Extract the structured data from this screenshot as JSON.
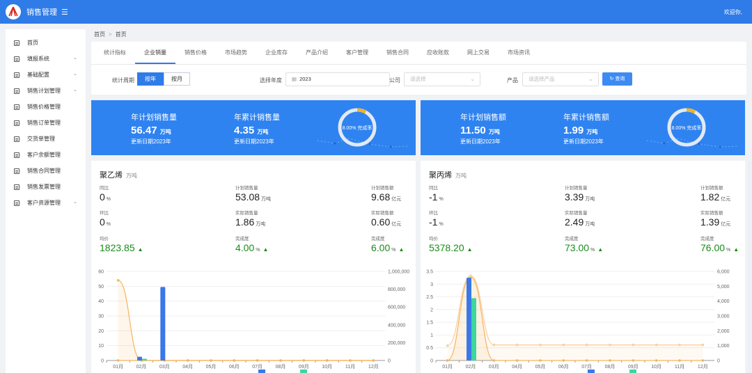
{
  "header": {
    "title": "销售管理",
    "welcome": "欢迎你,"
  },
  "sidebar": {
    "items": [
      {
        "label": "首页",
        "chev": false
      },
      {
        "label": "填报系统",
        "chev": true
      },
      {
        "label": "基础配置",
        "chev": true
      },
      {
        "label": "销售计划管理",
        "chev": true
      },
      {
        "label": "销售价格管理",
        "chev": false
      },
      {
        "label": "销售订单管理",
        "chev": false
      },
      {
        "label": "交货单管理",
        "chev": false
      },
      {
        "label": "客户余额管理",
        "chev": false
      },
      {
        "label": "销售合同管理",
        "chev": false
      },
      {
        "label": "销售发票管理",
        "chev": false
      },
      {
        "label": "客户资源管理",
        "chev": true
      }
    ]
  },
  "breadcrumb": [
    "首页",
    "首页"
  ],
  "tabs": [
    "统计指标",
    "企业销量",
    "销售价格",
    "市场趋势",
    "企业库存",
    "产品介绍",
    "客户管理",
    "销售合同",
    "应收账款",
    "网上交易",
    "市场资讯"
  ],
  "active_tab": 1,
  "filters": {
    "period_label": "统计周期",
    "period_options": [
      "按年",
      "按月"
    ],
    "year_label": "选择年度",
    "year_value": "2023",
    "company_label": "公司",
    "company_placeholder": "请选择",
    "product_label": "产品",
    "product_placeholder": "请选择产品",
    "query_label": "查询"
  },
  "kpi_left": {
    "a_label": "年计划销售量",
    "a_value": "56.47",
    "a_unit": "万吨",
    "a_date": "更新日期2023年",
    "b_label": "年累计销售量",
    "b_value": "4.35",
    "b_unit": "万吨",
    "b_date": "更新日期2023年",
    "ring_text": "8.00% 完成率",
    "ring_pct": 8
  },
  "kpi_right": {
    "a_label": "年计划销售额",
    "a_value": "11.50",
    "a_unit": "万吨",
    "a_date": "更新日期2023年",
    "b_label": "年累计销售额",
    "b_value": "1.99",
    "b_unit": "万吨",
    "b_date": "更新日期2023年",
    "ring_text": "8.00% 完成率",
    "ring_pct": 8
  },
  "card_left": {
    "title": "聚乙烯",
    "unit": "万吨",
    "yoy_label": "同比",
    "yoy_value": "0",
    "yoy_unit": "%",
    "plan_qty_label": "计划销售量",
    "plan_qty_value": "53.08",
    "plan_qty_unit": "万吨",
    "plan_amt_label": "计划销售额",
    "plan_amt_value": "9.68",
    "plan_amt_unit": "亿元",
    "mom_label": "环比",
    "mom_value": "0",
    "mom_unit": "%",
    "act_qty_label": "实际销售量",
    "act_qty_value": "1.86",
    "act_qty_unit": "万吨",
    "act_amt_label": "实际销售额",
    "act_amt_value": "0.60",
    "act_amt_unit": "亿元",
    "avg_label": "均价",
    "avg_value": "1823.85",
    "c1_label": "完成度",
    "c1_value": "4.00",
    "c1_unit": "%",
    "c2_label": "完成度",
    "c2_value": "6.00",
    "c2_unit": "%"
  },
  "card_right": {
    "title": "聚丙烯",
    "unit": "万吨",
    "yoy_label": "同比",
    "yoy_value": "-1",
    "yoy_unit": "%",
    "plan_qty_label": "计划销售量",
    "plan_qty_value": "3.39",
    "plan_qty_unit": "万吨",
    "plan_amt_label": "计划销售额",
    "plan_amt_value": "1.82",
    "plan_amt_unit": "亿元",
    "mom_label": "环比",
    "mom_value": "-1",
    "mom_unit": "%",
    "act_qty_label": "实际销售量",
    "act_qty_value": "2.49",
    "act_qty_unit": "万吨",
    "act_amt_label": "实际销售额",
    "act_amt_value": "1.39",
    "act_amt_unit": "亿元",
    "avg_label": "均价",
    "avg_value": "5378.20",
    "c1_label": "完成度",
    "c1_value": "73.00",
    "c1_unit": "%",
    "c2_label": "完成度",
    "c2_value": "76.00",
    "c2_unit": "%"
  },
  "chart_data": [
    {
      "type": "bar",
      "categories": [
        "01月",
        "02月",
        "03月",
        "04月",
        "05月",
        "06月",
        "07月",
        "08月",
        "09月",
        "10月",
        "11月",
        "12月"
      ],
      "ylim_left": [
        0,
        60
      ],
      "yticks_left": [
        "0",
        "10",
        "20",
        "30",
        "40",
        "50",
        "60"
      ],
      "ylim_right": [
        0,
        1000000
      ],
      "yticks_right": [
        "0",
        "200,000",
        "400,000",
        "600,000",
        "800,000",
        "1,000,000"
      ],
      "series": [
        {
          "kind": "bar",
          "axis": "left",
          "color": "#3a78e8",
          "values": [
            0,
            2.5,
            49.5,
            0,
            0,
            0,
            0,
            0,
            0,
            0,
            0,
            0
          ]
        },
        {
          "kind": "bar",
          "axis": "left",
          "color": "#3dd6a0",
          "values": [
            0,
            1.2,
            0,
            0,
            0,
            0,
            0,
            0,
            0,
            0,
            0,
            0
          ]
        },
        {
          "kind": "line",
          "axis": "right",
          "color": "#f5b35a",
          "values": [
            900000,
            0,
            0,
            0,
            0,
            0,
            0,
            0,
            0,
            0,
            0,
            0
          ]
        },
        {
          "kind": "line",
          "axis": "right",
          "color": "#f5b35a",
          "values": [
            0,
            0,
            0,
            0,
            0,
            0,
            0,
            0,
            0,
            0,
            0,
            0
          ]
        }
      ]
    },
    {
      "type": "bar",
      "categories": [
        "01月",
        "02月",
        "03月",
        "04月",
        "05月",
        "06月",
        "07月",
        "08月",
        "09月",
        "10月",
        "11月",
        "12月"
      ],
      "ylim_left": [
        0,
        3.5
      ],
      "yticks_left": [
        "0",
        "0.5",
        "1",
        "1.5",
        "2",
        "2.5",
        "3",
        "3.5"
      ],
      "ylim_right": [
        0,
        6000
      ],
      "yticks_right": [
        "0",
        "1,000",
        "2,000",
        "3,000",
        "4,000",
        "5,000",
        "6,000"
      ],
      "series": [
        {
          "kind": "bar",
          "axis": "left",
          "color": "#3a78e8",
          "values": [
            0,
            3.25,
            0,
            0,
            0,
            0,
            0,
            0,
            0,
            0,
            0,
            0
          ]
        },
        {
          "kind": "bar",
          "axis": "left",
          "color": "#3dd6a0",
          "values": [
            0,
            2.45,
            0,
            0,
            0,
            0,
            0,
            0,
            0,
            0,
            0,
            0
          ]
        },
        {
          "kind": "line",
          "axis": "right",
          "color": "#f5b35a",
          "values": [
            0,
            5600,
            0,
            0,
            0,
            0,
            0,
            0,
            0,
            0,
            0,
            0
          ]
        },
        {
          "kind": "line",
          "axis": "right",
          "color": "#f8cfa0",
          "values": [
            1000,
            5700,
            1050,
            1050,
            1050,
            1050,
            1050,
            1050,
            1050,
            1050,
            1050,
            1050
          ]
        }
      ]
    }
  ]
}
